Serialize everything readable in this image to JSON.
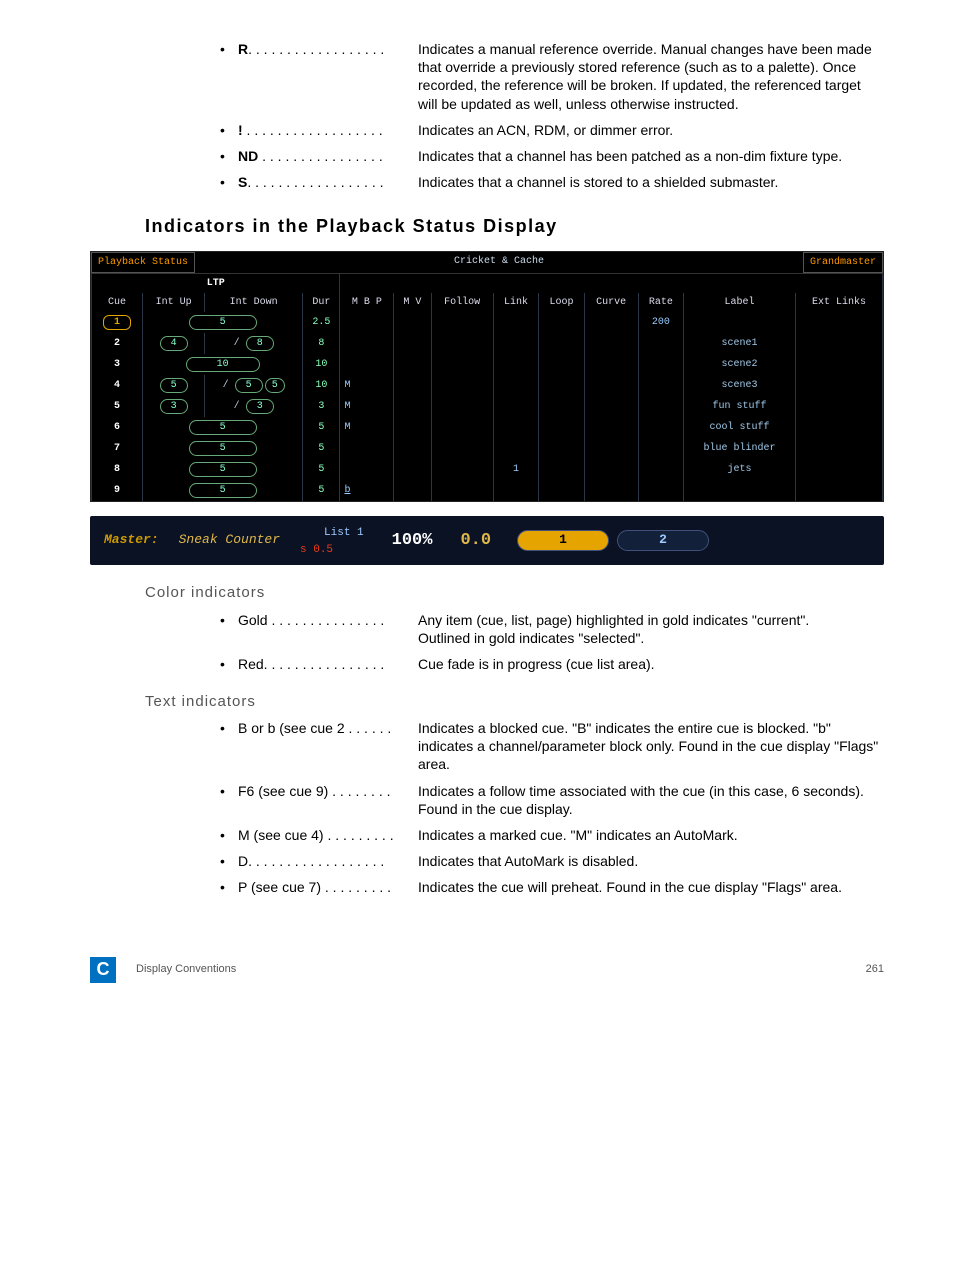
{
  "top_defs": [
    {
      "term": "R",
      "dots": ". . . . . . . . . . . . . . . . . .",
      "desc": "Indicates a manual reference override. Manual changes have been made that override a previously stored reference (such as to a palette). Once recorded, the reference will be broken. If updated, the referenced target will be updated as well, unless otherwise instructed."
    },
    {
      "term": "!",
      "dots": " . . . . . . . . . . . . . . . . . .",
      "desc": "Indicates an ACN, RDM, or dimmer error."
    },
    {
      "term": "ND",
      "dots": "  . . . . . . . . . . . . . . . .",
      "desc": "Indicates that a channel has been patched as a non-dim fixture type."
    },
    {
      "term": "S",
      "dots": ". . . . . . . . . . . . . . . . . .",
      "desc": "Indicates that a channel is stored to a shielded submaster."
    }
  ],
  "h2": "Indicators in the Playback Status Display",
  "shot": {
    "header_left": "Playback Status",
    "header_mid": "Cricket & Cache",
    "header_right": "Grandmaster",
    "ltp": "LTP",
    "cols": [
      "Cue",
      "Int Up",
      "Int Down",
      "Dur",
      "M B P",
      "M V",
      "Follow",
      "Link",
      "Loop",
      "Curve",
      "Rate",
      "Label",
      "Ext Links"
    ],
    "rows": [
      {
        "cue": "1",
        "updown": "5",
        "dur": "2.5",
        "mbp": "",
        "follow": "",
        "link": "",
        "rate": "200",
        "label": "",
        "gold": true
      },
      {
        "cue": "2",
        "up": "4",
        "down": "8",
        "dur": "8",
        "mbp": "",
        "follow": "",
        "link": "",
        "rate": "",
        "label": "scene1"
      },
      {
        "cue": "3",
        "updown": "10",
        "dur": "10",
        "mbp": "",
        "follow": "",
        "link": "",
        "rate": "",
        "label": "scene2"
      },
      {
        "cue": "4",
        "up": "5",
        "down": "5",
        "extra": "5",
        "dur": "10",
        "mbp": "M",
        "follow": "",
        "link": "",
        "rate": "",
        "label": "scene3"
      },
      {
        "cue": "5",
        "up": "3",
        "down": "3",
        "dur": "3",
        "mbp": "M",
        "follow": "",
        "link": "",
        "rate": "",
        "label": "fun stuff"
      },
      {
        "cue": "6",
        "updown": "5",
        "dur": "5",
        "mbp": "M",
        "follow": "",
        "link": "",
        "rate": "",
        "label": "cool stuff"
      },
      {
        "cue": "7",
        "updown": "5",
        "dur": "5",
        "mbp": "",
        "follow": "",
        "link": "",
        "rate": "",
        "label": "blue blinder"
      },
      {
        "cue": "8",
        "updown": "5",
        "dur": "5",
        "mbp": "",
        "follow": "",
        "link": "1",
        "rate": "",
        "label": "jets"
      },
      {
        "cue": "9",
        "updown": "5",
        "dur": "5",
        "mbp": "b",
        "underline": true,
        "follow": "",
        "link": "",
        "rate": "",
        "label": ""
      }
    ]
  },
  "master": {
    "label": "Master:",
    "sneak": "Sneak Counter",
    "list": "List 1",
    "red": "s 0.5",
    "pct": "100%",
    "zero": "0.0",
    "b1": "1",
    "b2": "2"
  },
  "h3a": "Color indicators",
  "color_defs": [
    {
      "term": "Gold",
      "dots": " . . . . . . . . . . . . . . .",
      "desc": "Any item (cue, list, page) highlighted in gold indicates \"current\".\nOutlined in gold indicates \"selected\"."
    },
    {
      "term": "Red",
      "dots": ". . . . . . . . . . . . . . . .",
      "desc": "Cue fade is in progress (cue list area)."
    }
  ],
  "h3b": "Text indicators",
  "text_defs": [
    {
      "term": "B or b (see cue 2",
      "dots": " . . . . . .",
      "desc": "Indicates a blocked cue. \"B\" indicates the entire cue is blocked. \"b\" indicates a channel/parameter block only. Found in the cue display \"Flags\" area."
    },
    {
      "term": "F6 (see cue 9)",
      "dots": " . . . . . . . .",
      "desc": "Indicates a follow time associated with the cue (in this case, 6 seconds). Found in the cue display."
    },
    {
      "term": "M (see cue 4)",
      "dots": " . . . . . . . . .",
      "desc": "Indicates a marked cue. \"M\" indicates an AutoMark."
    },
    {
      "term": "D",
      "dots": ". . . . . . . . . . . . . . . . . .",
      "desc": "Indicates that AutoMark is disabled."
    },
    {
      "term": "P (see cue 7)",
      "dots": " . . . . . . . . .",
      "desc": "Indicates the cue will preheat. Found in the cue display \"Flags\" area."
    }
  ],
  "footer": {
    "letter": "C",
    "section": "Display Conventions",
    "page": "261"
  }
}
